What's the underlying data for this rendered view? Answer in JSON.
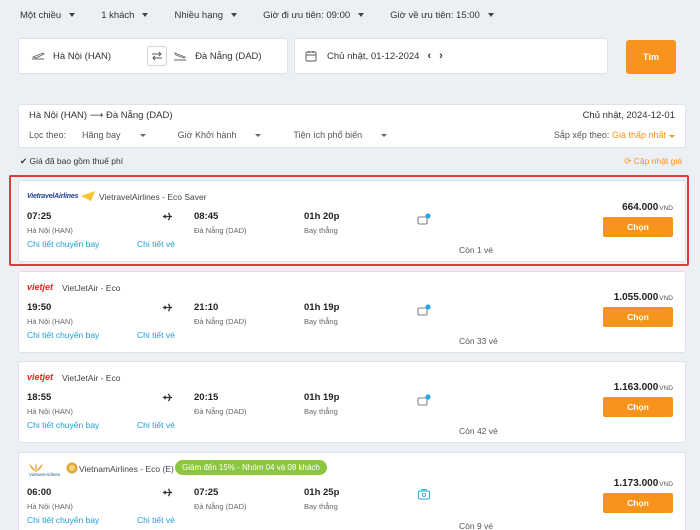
{
  "filters": {
    "trip_type": "Một chiều",
    "passengers": "1 khách",
    "cabin": "Nhiều hạng",
    "outbound_time": "Giờ đi ưu tiên: 09:00",
    "return_time": "Giờ về ưu tiên: 15:00"
  },
  "search": {
    "from": "Hà Nội (HAN)",
    "to": "Đà Nẵng (DAD)",
    "date": "Chủ nhật, 01-12-2024",
    "prev": "‹",
    "next": "›",
    "button": "Tìm"
  },
  "results": {
    "route": "Hà Nội (HAN) ⟶ Đà Nẵng (DAD)",
    "date": "Chủ nhật, 2024-12-01",
    "filter_label": "Lọc theo:",
    "filter_airline": "Hãng bay",
    "filter_departure": "Giờ Khởi hành",
    "filter_amenities": "Tiện ích phổ biến",
    "sort_label": "Sắp xếp theo:",
    "sort_value": "Giá thấp nhất",
    "tax_note": "Giá đã bao gồm thuế phí",
    "refresh": "Cập nhật giá"
  },
  "colors": {
    "accent": "#f7941d",
    "link": "#1a9fd8",
    "highlight": "#e03a3a",
    "promo": "#8cc63f"
  },
  "flights": [
    {
      "logo": "VietravelAirlines",
      "airline": "VietravelAirlines - Eco Saver",
      "dep_time": "07:25",
      "dep_place": "Hà Nội (HAN)",
      "arr_time": "08:45",
      "arr_place": "Đà Nẵng (DAD)",
      "duration": "01h 20p",
      "stops": "Bay thẳng",
      "detail_link": "Chi tiết chuyến bay",
      "ticket_link": "Chi tiết vé",
      "seats": "Còn 1 vé",
      "price": "664.000",
      "currency": "VND",
      "choose": "Chọn",
      "amenity_icon": "luggage-plus-icon"
    },
    {
      "logo": "vietjet",
      "airline": "VietJetAir - Eco",
      "dep_time": "19:50",
      "dep_place": "Hà Nội (HAN)",
      "arr_time": "21:10",
      "arr_place": "Đà Nẵng (DAD)",
      "duration": "01h 19p",
      "stops": "Bay thẳng",
      "detail_link": "Chi tiết chuyến bay",
      "ticket_link": "Chi tiết vé",
      "seats": "Còn 33 vé",
      "price": "1.055.000",
      "currency": "VND",
      "choose": "Chọn",
      "amenity_icon": "luggage-plus-icon"
    },
    {
      "logo": "vietjet",
      "airline": "VietJetAir - Eco",
      "dep_time": "18:55",
      "dep_place": "Hà Nội (HAN)",
      "arr_time": "20:15",
      "arr_place": "Đà Nẵng (DAD)",
      "duration": "01h 19p",
      "stops": "Bay thẳng",
      "detail_link": "Chi tiết chuyến bay",
      "ticket_link": "Chi tiết vé",
      "seats": "Còn 42 vé",
      "price": "1.163.000",
      "currency": "VND",
      "choose": "Chọn",
      "amenity_icon": "luggage-plus-icon"
    },
    {
      "logo": "VietnamAirlines",
      "airline": "VietnamAirlines - Eco (E)",
      "promo": "Giảm đến 15% - Nhóm 04 và 08 khách",
      "dep_time": "06:00",
      "dep_place": "Hà Nội (HAN)",
      "arr_time": "07:25",
      "arr_place": "Đà Nẵng (DAD)",
      "duration": "01h 25p",
      "stops": "Bay thẳng",
      "detail_link": "Chi tiết chuyến bay",
      "ticket_link": "Chi tiết vé",
      "seats": "Còn 9 vé",
      "price": "1.173.000",
      "currency": "VND",
      "choose": "Chọn",
      "amenity_icon": "baggage-icon"
    }
  ]
}
